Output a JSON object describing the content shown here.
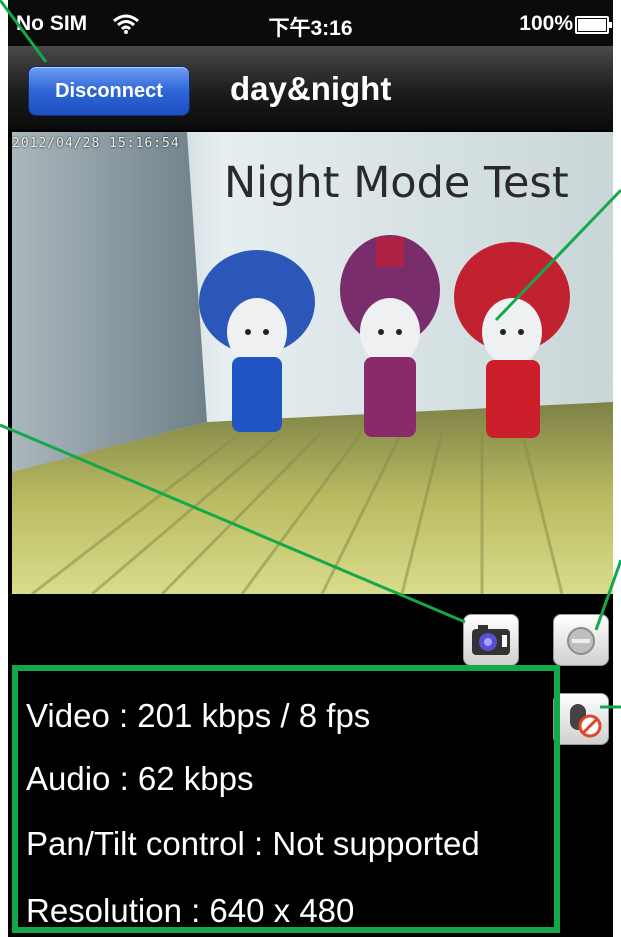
{
  "status_bar": {
    "carrier": "No SIM",
    "time": "下午3:16",
    "battery": "100%"
  },
  "nav": {
    "disconnect_label": "Disconnect",
    "title": "day&night"
  },
  "video": {
    "timestamp": "2012/04/28 15:16:54",
    "overlay_text": "Night Mode Test"
  },
  "icons": {
    "snapshot": "camera-icon",
    "record": "record-icon",
    "mic": "microphone-muted-icon"
  },
  "info": {
    "video": "Video : 201 kbps / 8 fps",
    "audio": "Audio : 62 kbps",
    "pan_tilt": "Pan/Tilt control : Not supported",
    "resolution": "Resolution : 640 x 480"
  },
  "colors": {
    "highlight": "#13a94a",
    "button_blue": "#2f66d8",
    "background": "#000000"
  }
}
